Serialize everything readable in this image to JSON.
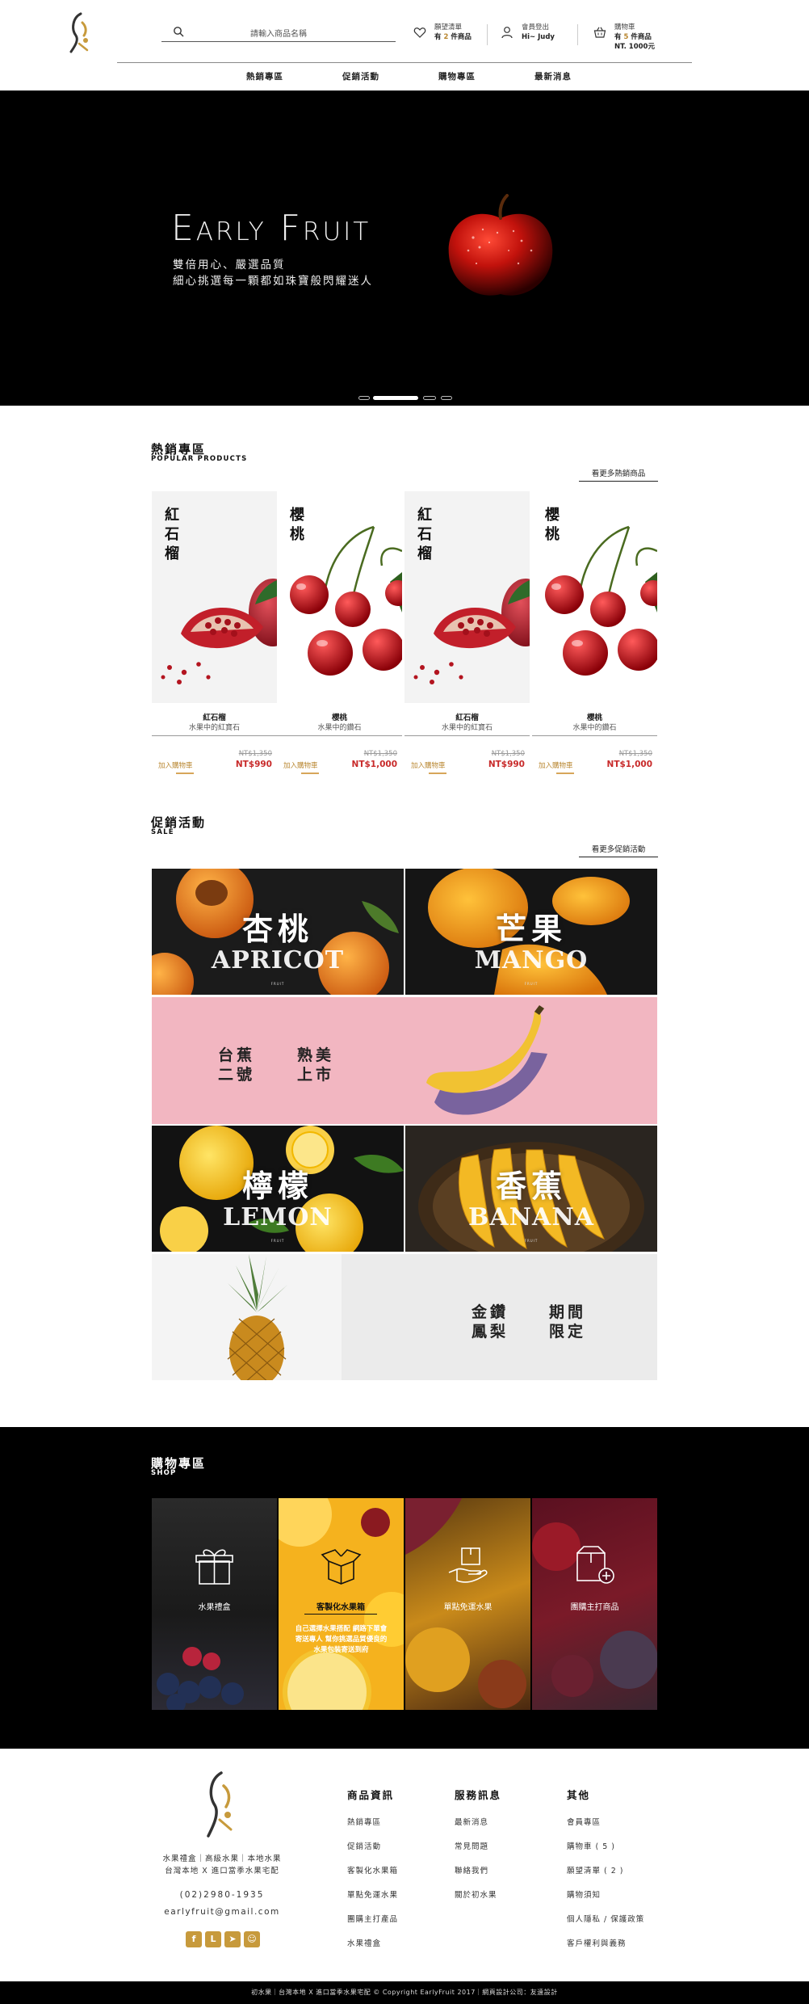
{
  "header": {
    "search_placeholder": "請輸入商品名稱",
    "wishlist": {
      "label": "願望清單",
      "prefix": "有",
      "count": "2",
      "suffix": "件商品"
    },
    "member": {
      "label": "會員登出",
      "greeting": "Hi~ Judy"
    },
    "cart": {
      "label": "購物車",
      "prefix": "有",
      "count": "5",
      "suffix": "件商品",
      "total": "NT. 1000元"
    },
    "nav": [
      "熱銷專區",
      "促銷活動",
      "購物專區",
      "最新消息"
    ]
  },
  "hero": {
    "title": "Early Fruit",
    "subtitle_line1": "雙倍用心、嚴選品質",
    "subtitle_line2": "細心挑選每一顆都如珠寶般閃耀迷人"
  },
  "popular": {
    "title": "熱銷專區",
    "subtitle": "POPULAR PRODUCTS",
    "more": "看更多熱銷商品",
    "cart_label": "加入購物車",
    "products": [
      {
        "vertical_name": "紅石榴",
        "name": "紅石榴",
        "desc": "水果中的紅寶石",
        "old_price": "NT$1,350",
        "price": "NT$990"
      },
      {
        "vertical_name": "櫻桃",
        "name": "櫻桃",
        "desc": "水果中的鑽石",
        "old_price": "NT$1,350",
        "price": "NT$1,000"
      },
      {
        "vertical_name": "紅石榴",
        "name": "紅石榴",
        "desc": "水果中的紅寶石",
        "old_price": "NT$1,350",
        "price": "NT$990"
      },
      {
        "vertical_name": "櫻桃",
        "name": "櫻桃",
        "desc": "水果中的鑽石",
        "old_price": "NT$1,350",
        "price": "NT$1,000"
      }
    ]
  },
  "sale": {
    "title": "促銷活動",
    "subtitle": "SALE",
    "more": "看更多促銷活動",
    "apricot": {
      "cn": "杏桃",
      "en": "APRICOT",
      "tag": "FRUIT"
    },
    "mango": {
      "cn": "芒果",
      "en": "MANGO",
      "tag": "FRUIT"
    },
    "banana_banner": {
      "col1": "台蕉",
      "col2": "二號",
      "col3": "熟美",
      "col4": "上市"
    },
    "lemon": {
      "cn": "檸檬",
      "en": "LEMON",
      "tag": "FRUIT"
    },
    "banana": {
      "cn": "香蕉",
      "en": "BANANA",
      "tag": "FRUIT"
    },
    "pineapple_banner": {
      "col1": "金鑽",
      "col2": "鳳梨",
      "col3": "期間",
      "col4": "限定"
    }
  },
  "shop": {
    "title": "購物專區",
    "subtitle": "SHOP",
    "tiles": [
      {
        "label": "水果禮盒",
        "icon": "gift-icon"
      },
      {
        "label": "客製化水果箱",
        "icon": "open-box-icon",
        "desc": "自己選擇水果搭配 網路下單會寄送專人 幫你挑選品質優良的 水果包裝寄送到府"
      },
      {
        "label": "單點免運水果",
        "icon": "delivery-hand-icon"
      },
      {
        "label": "團購主打商品",
        "icon": "group-buy-box-icon"
      }
    ]
  },
  "footer": {
    "tagline1": "水果禮盒｜高級水果｜本地水果",
    "tagline2": "台灣本地 X 進口當季水果宅配",
    "phone": "(02)2980-1935",
    "email": "earlyfruit@gmail.com",
    "columns": [
      {
        "title": "商品資訊",
        "links": [
          "熱銷專區",
          "促銷活動",
          "客製化水果箱",
          "單點免運水果",
          "團購主打產品",
          "水果禮盒"
        ]
      },
      {
        "title": "服務訊息",
        "links": [
          "最新消息",
          "常見問題",
          "聯絡我們",
          "關於初水果"
        ]
      },
      {
        "title": "其他",
        "links": [
          "會員專區",
          "購物車 ( 5 )",
          "願望清單 ( 2 )",
          "購物須知",
          "個人隱私 / 保護政策",
          "客戶權利與義務"
        ]
      }
    ],
    "copyright": "初水果｜台灣本地 X 進口當季水果宅配 © Copyright EarlyFruit 2017｜網頁設計公司：友遠設計"
  },
  "colors": {
    "accent": "#b8862f",
    "price_red": "#c82a2a",
    "banana_pink": "#f2b6c1",
    "pineapple_gray": "#ebebeb"
  }
}
